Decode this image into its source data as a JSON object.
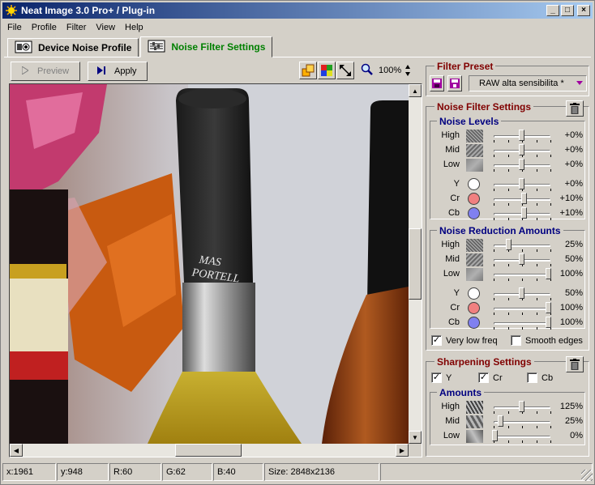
{
  "window": {
    "title": "Neat Image 3.0 Pro+ / Plug-in",
    "minimize": "_",
    "maximize": "□",
    "close": "×"
  },
  "menu": [
    "File",
    "Profile",
    "Filter",
    "View",
    "Help"
  ],
  "tabs": [
    {
      "label": "Device Noise Profile",
      "icon": "profile-icon",
      "active": false
    },
    {
      "label": "Noise Filter Settings",
      "icon": "filter-settings-icon",
      "active": true
    }
  ],
  "toolbar": {
    "preview_label": "Preview",
    "apply_label": "Apply",
    "zoom": "100%",
    "icons": [
      "overlap-view-icon",
      "color-channels-icon",
      "fit-arrows-icon",
      "magnifier-icon"
    ]
  },
  "filter_preset": {
    "title": "Filter Preset",
    "value": "RAW alta sensibilita *",
    "accent": "#800000"
  },
  "noise_filter_settings": {
    "title": "Noise Filter Settings",
    "noise_levels": {
      "title": "Noise Levels",
      "rows": [
        {
          "label": "High",
          "value": "+0%",
          "pos": 0.5,
          "kind": "noise-high"
        },
        {
          "label": "Mid",
          "value": "+0%",
          "pos": 0.5,
          "kind": "noise-mid"
        },
        {
          "label": "Low",
          "value": "+0%",
          "pos": 0.5,
          "kind": "noise-low"
        },
        {
          "label": "Y",
          "value": "+0%",
          "pos": 0.5,
          "color": "#ffffff"
        },
        {
          "label": "Cr",
          "value": "+10%",
          "pos": 0.55,
          "color": "#f08080"
        },
        {
          "label": "Cb",
          "value": "+10%",
          "pos": 0.55,
          "color": "#8080f0"
        }
      ]
    },
    "noise_reduction": {
      "title": "Noise Reduction Amounts",
      "rows": [
        {
          "label": "High",
          "value": "25%",
          "pos": 0.25,
          "kind": "noise-high"
        },
        {
          "label": "Mid",
          "value": "50%",
          "pos": 0.5,
          "kind": "noise-mid"
        },
        {
          "label": "Low",
          "value": "100%",
          "pos": 1.0,
          "kind": "noise-low"
        },
        {
          "label": "Y",
          "value": "50%",
          "pos": 0.5,
          "color": "#ffffff"
        },
        {
          "label": "Cr",
          "value": "100%",
          "pos": 1.0,
          "color": "#f08080"
        },
        {
          "label": "Cb",
          "value": "100%",
          "pos": 1.0,
          "color": "#8080f0"
        }
      ]
    },
    "very_low_freq": {
      "label": "Very low freq",
      "checked": true
    },
    "smooth_edges": {
      "label": "Smooth edges",
      "checked": false
    }
  },
  "sharpening": {
    "title": "Sharpening Settings",
    "channels": [
      {
        "label": "Y",
        "checked": true
      },
      {
        "label": "Cr",
        "checked": true
      },
      {
        "label": "Cb",
        "checked": false
      }
    ],
    "amounts": {
      "title": "Amounts",
      "rows": [
        {
          "label": "High",
          "value": "125%",
          "pos": 0.5,
          "kind": "sharp-high"
        },
        {
          "label": "Mid",
          "value": "25%",
          "pos": 0.1,
          "kind": "sharp-mid"
        },
        {
          "label": "Low",
          "value": "0%",
          "pos": 0.0,
          "kind": "sharp-low"
        }
      ]
    }
  },
  "status": {
    "x": "x:1961",
    "y": "y:948",
    "r": "R:60",
    "g": "G:62",
    "b": "B:40",
    "size": "Size: 2848x2136"
  }
}
